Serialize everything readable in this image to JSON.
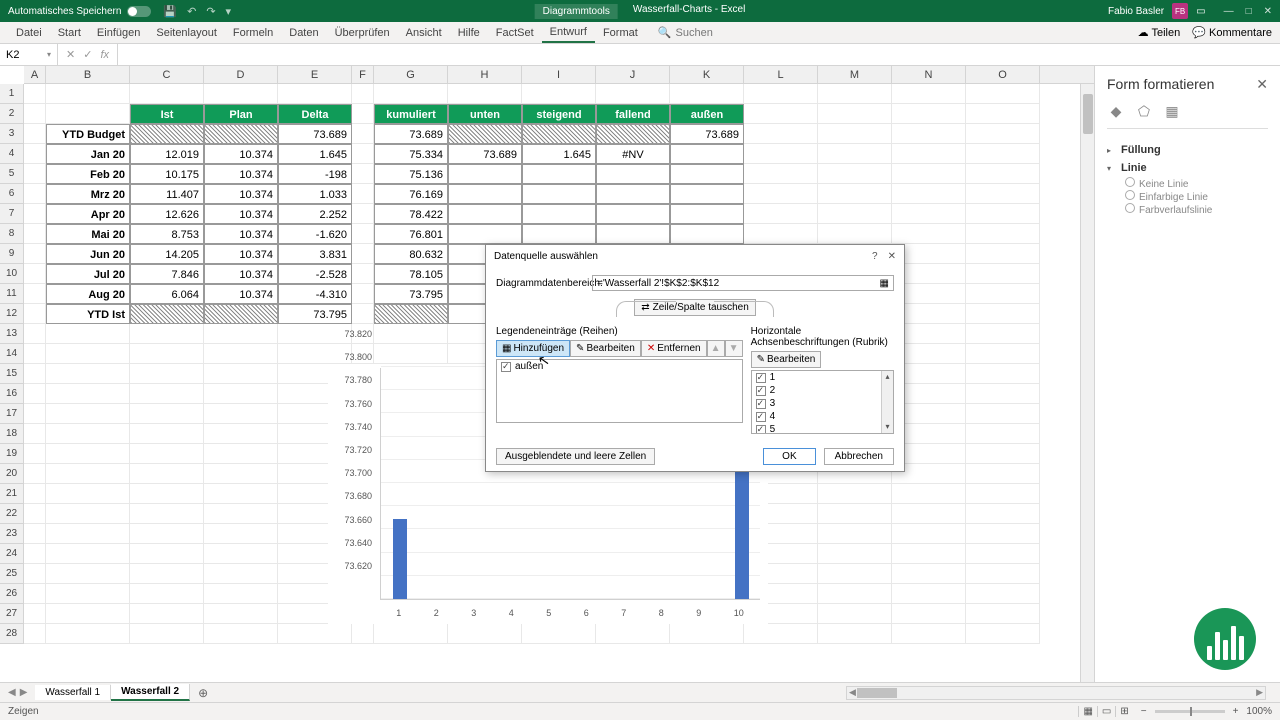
{
  "titlebar": {
    "autosave": "Automatisches Speichern",
    "chart_tools": "Diagrammtools",
    "doc_title": "Wasserfall-Charts - Excel",
    "user": "Fabio Basler",
    "initials": "FB"
  },
  "ribbon": {
    "tabs": [
      "Datei",
      "Start",
      "Einfügen",
      "Seitenlayout",
      "Formeln",
      "Daten",
      "Überprüfen",
      "Ansicht",
      "Hilfe",
      "FactSet",
      "Entwurf",
      "Format"
    ],
    "active": "Entwurf",
    "search": "Suchen",
    "share": "Teilen",
    "comments": "Kommentare"
  },
  "formula": {
    "namebox": "K2",
    "fx": "fx",
    "value": ""
  },
  "columns": [
    "A",
    "B",
    "C",
    "D",
    "E",
    "F",
    "G",
    "H",
    "I",
    "J",
    "K",
    "L",
    "M",
    "N",
    "O"
  ],
  "table1": {
    "headers": [
      "Ist",
      "Plan",
      "Delta"
    ],
    "row_labels": [
      "YTD Budget",
      "Jan 20",
      "Feb 20",
      "Mrz 20",
      "Apr 20",
      "Mai 20",
      "Jun 20",
      "Jul 20",
      "Aug 20",
      "YTD Ist"
    ],
    "rows": [
      [
        "",
        "",
        "73.689"
      ],
      [
        "12.019",
        "10.374",
        "1.645"
      ],
      [
        "10.175",
        "10.374",
        "-198"
      ],
      [
        "11.407",
        "10.374",
        "1.033"
      ],
      [
        "12.626",
        "10.374",
        "2.252"
      ],
      [
        "8.753",
        "10.374",
        "-1.620"
      ],
      [
        "14.205",
        "10.374",
        "3.831"
      ],
      [
        "7.846",
        "10.374",
        "-2.528"
      ],
      [
        "6.064",
        "10.374",
        "-4.310"
      ],
      [
        "",
        "",
        "73.795"
      ]
    ]
  },
  "table2": {
    "headers": [
      "kumuliert",
      "unten",
      "steigend",
      "fallend",
      "außen"
    ],
    "rows": [
      [
        "73.689",
        "",
        "",
        "",
        "73.689"
      ],
      [
        "75.334",
        "73.689",
        "1.645",
        "#NV",
        ""
      ],
      [
        "75.136",
        "",
        "",
        "",
        ""
      ],
      [
        "76.169",
        "",
        "",
        "",
        ""
      ],
      [
        "78.422",
        "",
        "",
        "",
        ""
      ],
      [
        "76.801",
        "",
        "",
        "",
        ""
      ],
      [
        "80.632",
        "",
        "",
        "",
        ""
      ],
      [
        "78.105",
        "",
        "",
        "",
        ""
      ],
      [
        "73.795",
        "",
        "",
        "",
        ""
      ],
      [
        "",
        "",
        "",
        "",
        ""
      ]
    ]
  },
  "chart_data": {
    "type": "bar",
    "categories": [
      "1",
      "2",
      "3",
      "4",
      "5",
      "6",
      "7",
      "8",
      "9",
      "10"
    ],
    "series": [
      {
        "name": "außen",
        "values": [
          73689,
          null,
          null,
          null,
          null,
          null,
          null,
          null,
          null,
          73795
        ]
      }
    ],
    "ylim": [
      73620,
      73820
    ],
    "yticks": [
      "73.620",
      "73.640",
      "73.660",
      "73.680",
      "73.700",
      "73.720",
      "73.740",
      "73.760",
      "73.780",
      "73.800",
      "73.820"
    ]
  },
  "dialog": {
    "title": "Datenquelle auswählen",
    "range_label": "Diagrammdatenbereich:",
    "range_value": "='Wasserfall 2'!$K$2:$K$12",
    "swap": "Zeile/Spalte tauschen",
    "legend_hdr": "Legendeneinträge (Reihen)",
    "axis_hdr": "Horizontale Achsenbeschriftungen (Rubrik)",
    "add": "Hinzufügen",
    "edit": "Bearbeiten",
    "remove": "Entfernen",
    "edit2": "Bearbeiten",
    "series": [
      "außen"
    ],
    "cats": [
      "1",
      "2",
      "3",
      "4",
      "5"
    ],
    "hidden": "Ausgeblendete und leere Zellen",
    "ok": "OK",
    "cancel": "Abbrechen"
  },
  "sidepane": {
    "title": "Form formatieren",
    "fill": "Füllung",
    "line": "Linie",
    "noline": "Keine Linie",
    "solid": "Einfarbige Linie",
    "gradient": "Farbverlaufslinie"
  },
  "sheets": {
    "tabs": [
      "Wasserfall 1",
      "Wasserfall 2"
    ],
    "active": 1
  },
  "status": {
    "left": "Zeigen",
    "zoom": "100%"
  }
}
